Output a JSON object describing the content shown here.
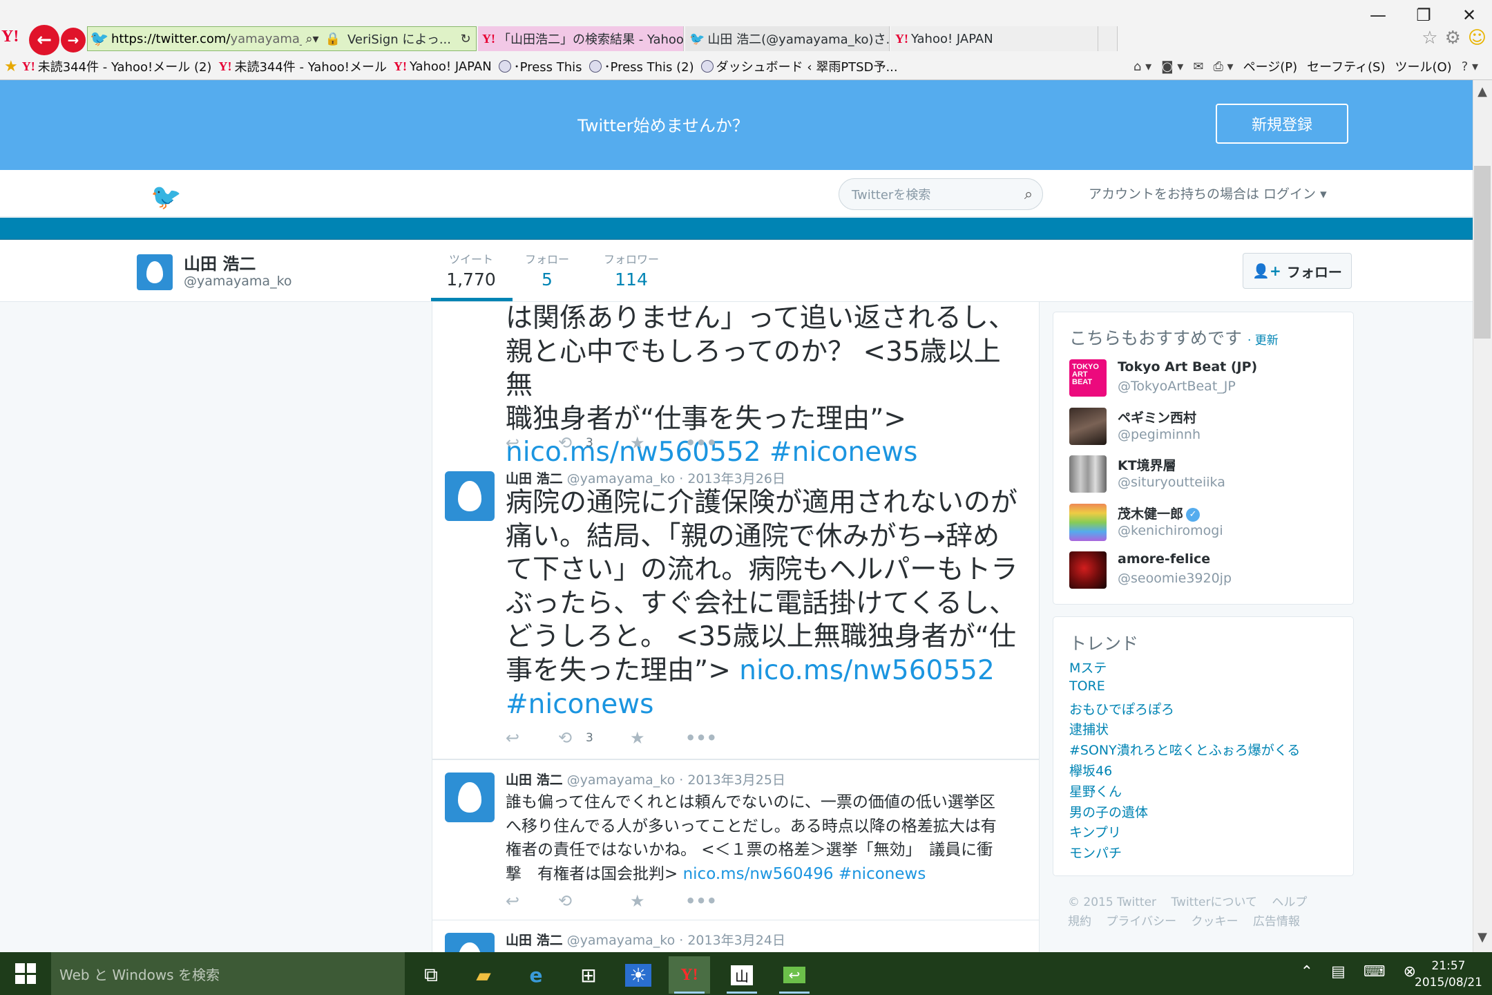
{
  "browser": {
    "url_host": "https://twitter.com/",
    "url_path": "yamayama_ko",
    "cert_label": "VeriSign によっ...",
    "tabs": [
      {
        "label": "「山田浩二」の検索結果 - Yahoo!...",
        "icon": "yahoo-icon"
      },
      {
        "label": "山田 浩二(@yamayama_ko)さ...",
        "icon": "twitter-icon"
      },
      {
        "label": "Yahoo! JAPAN",
        "icon": "yahoo-icon"
      }
    ],
    "favorites": [
      "未読344件 - Yahoo!メール (2)",
      "未読344件 - Yahoo!メール",
      "Yahoo! JAPAN",
      "･Press This",
      "･Press This (2)",
      "ダッシュボード ‹ 翠雨PTSD予..."
    ],
    "commands": {
      "page": "ページ(P)",
      "safety": "セーフティ(S)",
      "tools": "ツール(O)"
    }
  },
  "signup": {
    "text": "Twitter始めませんか？",
    "button": "新規登録"
  },
  "topnav": {
    "search_placeholder": "Twitterを検索",
    "login_text": "アカウントをお持ちの場合は ログイン ▾"
  },
  "profile": {
    "name": "山田 浩二",
    "handle": "@yamayama_ko",
    "stats": [
      {
        "label": "ツイート",
        "value": "1,770"
      },
      {
        "label": "フォロー",
        "value": "5"
      },
      {
        "label": "フォロワー",
        "value": "114"
      }
    ],
    "follow_button": "フォロー"
  },
  "tweets": [
    {
      "text_lines": [
        "は関係ありません」って追い返されるし、",
        "親と心中でもしろってのか？ <35歳以上無",
        "職独身者が“仕事を失った理由”>"
      ],
      "link": "nico.ms/nw560552",
      "hashtag": "#niconews",
      "retweets": "3"
    },
    {
      "name": "山田 浩二",
      "handle": "@yamayama_ko",
      "date": "· 2013年3月26日",
      "text_lines": [
        "病院の通院に介護保険が適用されないのが",
        "痛い。結局、「親の通院で休みがち→辞め",
        "て下さい」の流れ。病院もヘルパーもトラ",
        "ぶったら、すぐ会社に電話掛けてくるし、",
        "どうしろと。 <35歳以上無職独身者が“仕",
        "事を失った理由”>"
      ],
      "link": "nico.ms/nw560552",
      "hashtag": "#niconews",
      "retweets": "3"
    },
    {
      "name": "山田 浩二",
      "handle": "@yamayama_ko",
      "date": "· 2013年3月25日",
      "text_lines": [
        "誰も偏って住んでくれとは頼んでないのに、一票の価値の低い選挙区",
        "へ移り住んでる人が多いってことだし。ある時点以降の格差拡大は有",
        "権者の責任ではないかね。 <＜１票の格差＞選挙「無効」　議員に衝",
        "撃　有権者は国会批判>"
      ],
      "link": "nico.ms/nw560496",
      "hashtag": "#niconews",
      "retweets": ""
    },
    {
      "name": "山田 浩二",
      "handle": "@yamayama_ko",
      "date": "· 2013年3月24日"
    }
  ],
  "who_to_follow": {
    "title": "こちらもおすすめです",
    "refresh": "· 更新",
    "users": [
      {
        "name": "Tokyo Art Beat (JP)",
        "handle": "@TokyoArtBeat_JP",
        "pic_text": "TOKYO ART BEAT",
        "verified": false
      },
      {
        "name": "ペギミン西村",
        "handle": "@pegiminnh",
        "verified": false
      },
      {
        "name": "KT境界層",
        "handle": "@situryoutteiika",
        "verified": false
      },
      {
        "name": "茂木健一郎",
        "handle": "@kenichiromogi",
        "verified": true
      },
      {
        "name": "amore-felice",
        "handle": "@seoomie3920jp",
        "verified": false
      }
    ]
  },
  "trends": {
    "title": "トレンド",
    "items": [
      "Mステ",
      "TORE",
      "おもひでぽろぽろ",
      "逮捕状",
      "#SONY潰れろと呟くとふぉろ爆がくる",
      "欅坂46",
      "星野くん",
      "男の子の遺体",
      "キンプリ",
      "モンパチ"
    ]
  },
  "footer": {
    "links": [
      "© 2015 Twitter",
      "Twitterについて",
      "ヘルプ",
      "規約",
      "プライバシー",
      "クッキー",
      "広告情報"
    ]
  },
  "taskbar": {
    "search_placeholder": "Web と Windows を検索",
    "time": "21:57",
    "date": "2015/08/21"
  },
  "colors": {
    "twitter_blue": "#55acee",
    "link": "#1b95e0",
    "profile_bar": "#0084b4",
    "taskbar": "#1e3c1a"
  }
}
